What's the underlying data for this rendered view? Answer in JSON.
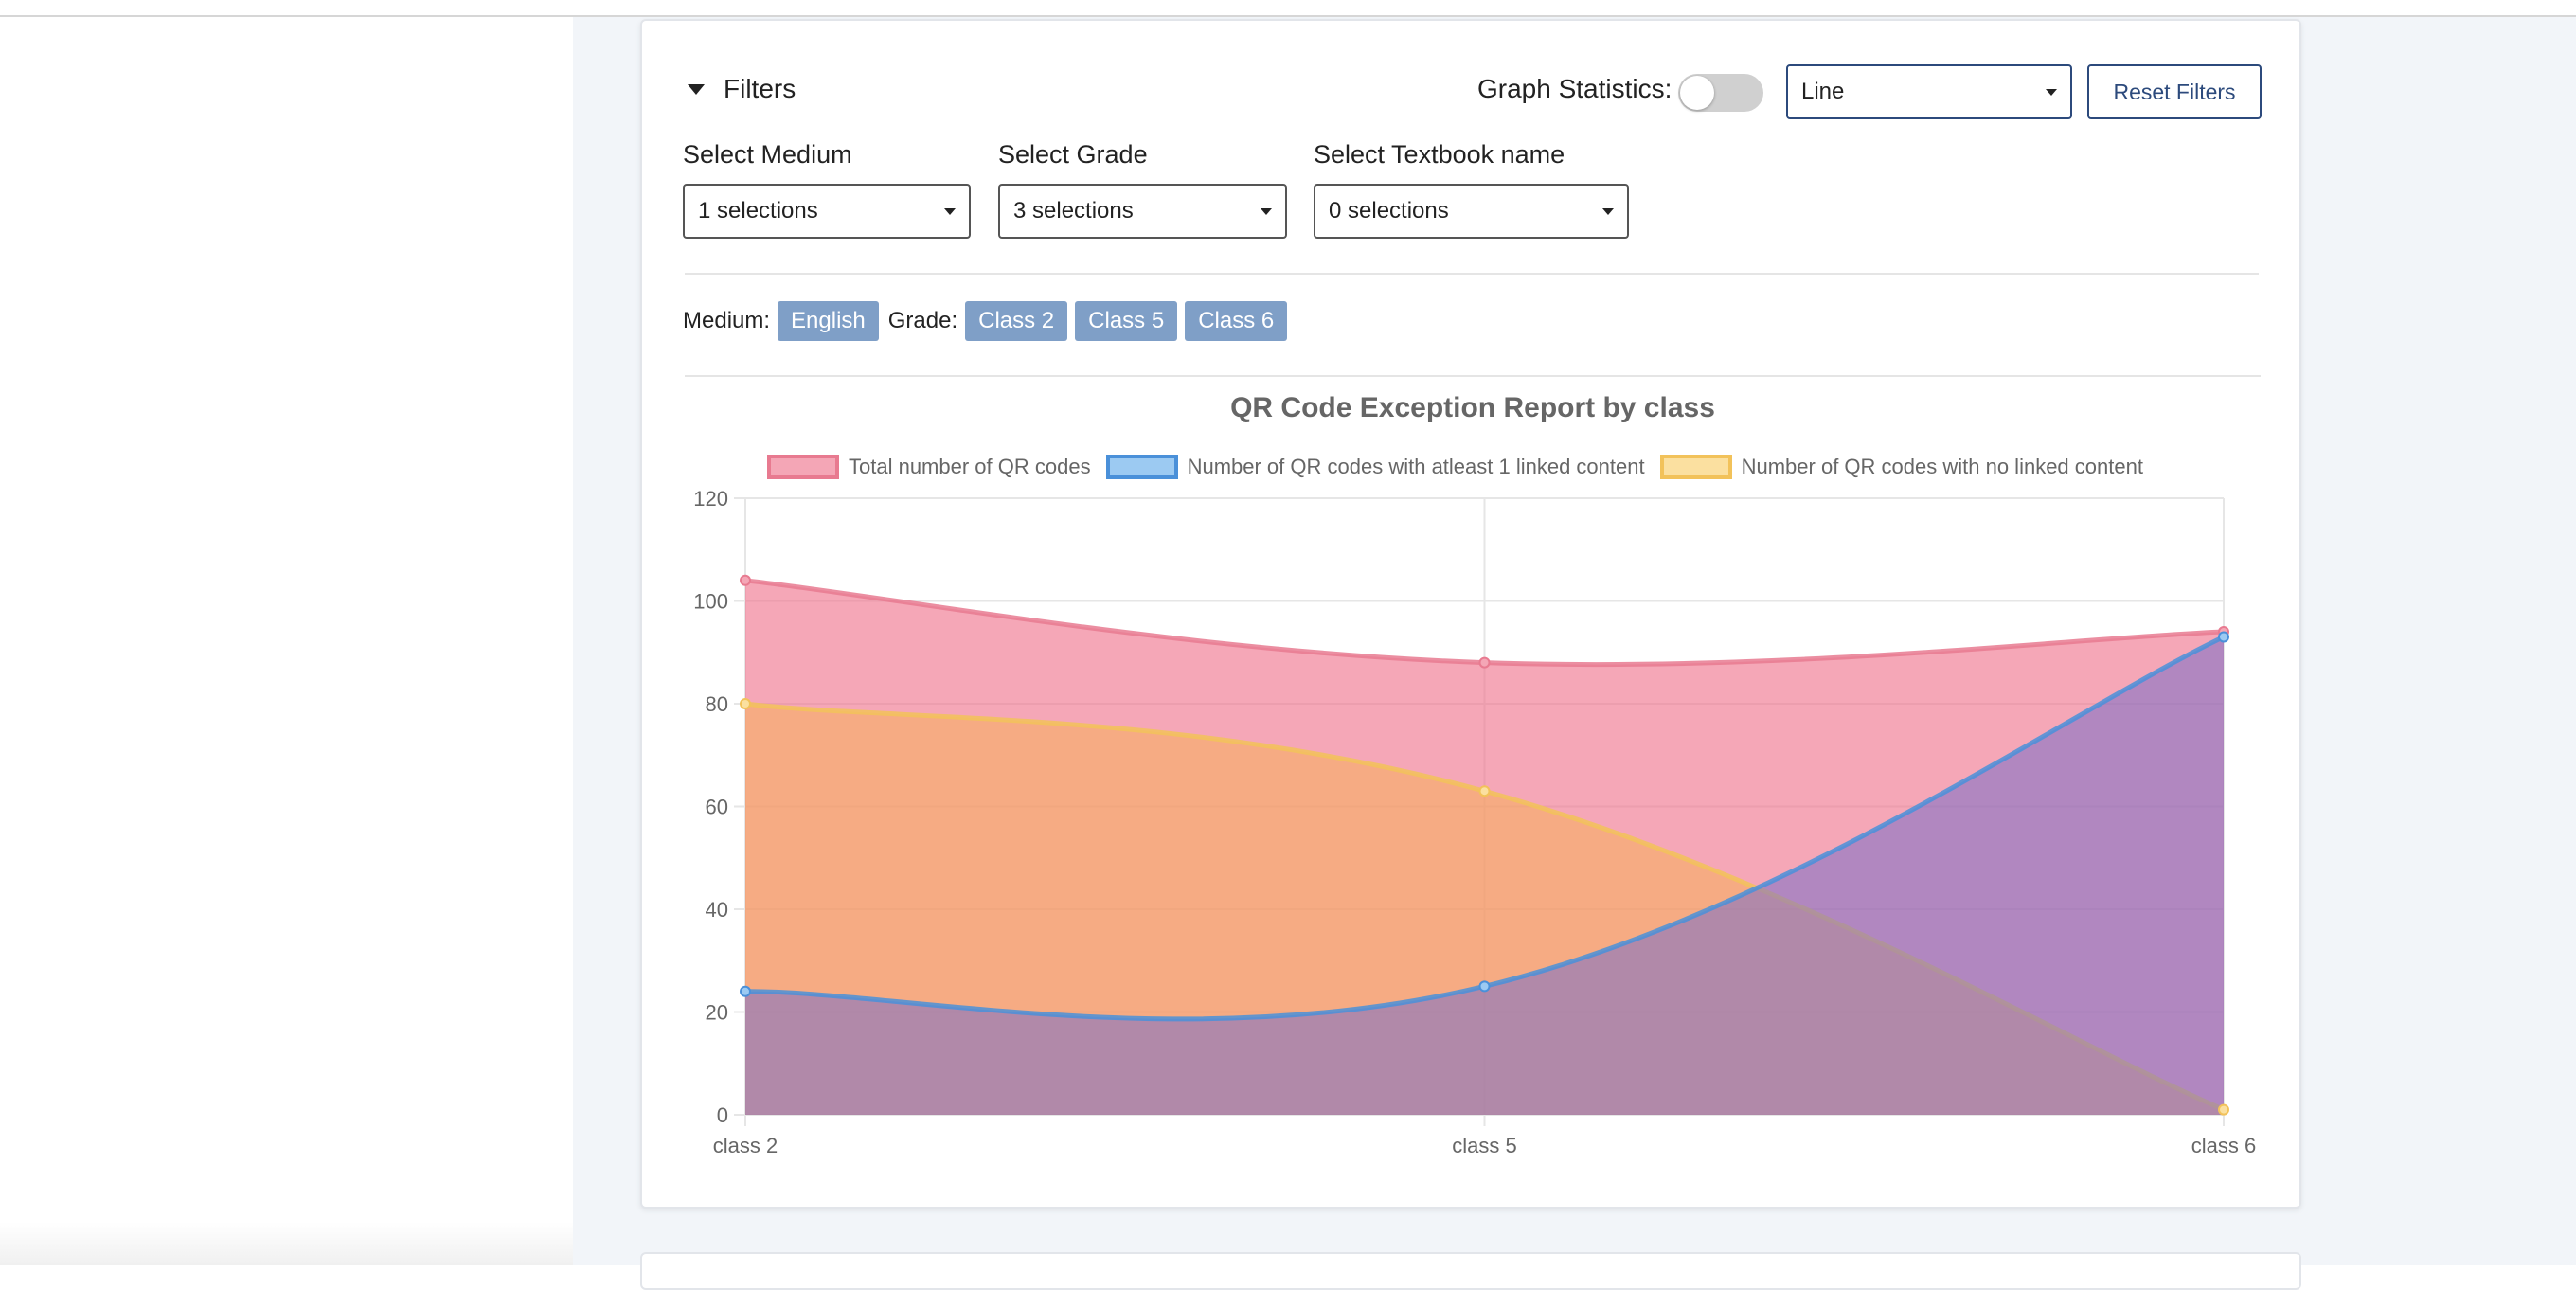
{
  "filters": {
    "toggle_label": "Filters",
    "graph_statistics_label": "Graph Statistics:",
    "graph_type_value": "Line",
    "reset_label": "Reset Filters",
    "medium": {
      "label": "Select Medium",
      "value": "1 selections"
    },
    "grade": {
      "label": "Select Grade",
      "value": "3 selections"
    },
    "textbook": {
      "label": "Select Textbook name",
      "value": "0 selections"
    }
  },
  "chips": {
    "medium_label": "Medium:",
    "medium_values": [
      "English"
    ],
    "grade_label": "Grade:",
    "grade_values": [
      "Class 2",
      "Class 5",
      "Class 6"
    ]
  },
  "chart_data": {
    "type": "area",
    "title": "QR Code Exception Report by class",
    "categories": [
      "class 2",
      "class 5",
      "class 6"
    ],
    "ylim": [
      0,
      120
    ],
    "yticks": [
      0,
      20,
      40,
      60,
      80,
      100,
      120
    ],
    "grid": true,
    "legend_position": "top",
    "series": [
      {
        "name": "Total number of QR codes",
        "values": [
          104,
          88,
          94
        ],
        "border": "#e87a90",
        "fill": "#f4a6b6"
      },
      {
        "name": "Number of QR codes with atleast 1 linked content",
        "values": [
          24,
          25,
          93
        ],
        "border": "#4a90d9",
        "fill": "#9ccaf2"
      },
      {
        "name": "Number of QR codes with no linked content",
        "values": [
          80,
          63,
          1
        ],
        "border": "#f2c25a",
        "fill": "#fbe0a0"
      }
    ]
  }
}
